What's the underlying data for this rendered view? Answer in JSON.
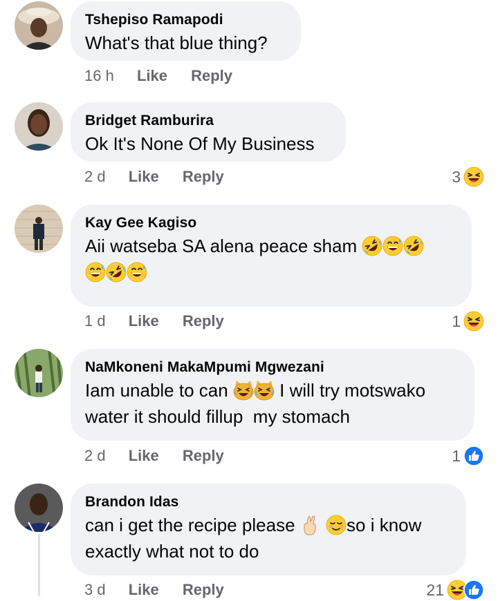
{
  "comments": [
    {
      "author": "Tshepiso Ramapodi",
      "text": "What's that blue thing?",
      "time": "16 h",
      "like": "Like",
      "reply": "Reply",
      "reaction_count": ""
    },
    {
      "author": "Bridget Ramburira",
      "text": "Ok It's None Of My Business",
      "time": "2 d",
      "like": "Like",
      "reply": "Reply",
      "reaction_count": "3"
    },
    {
      "author": "Kay Gee Kagiso",
      "text_line1": "Aii watseba SA alena peace sham",
      "time": "1 d",
      "like": "Like",
      "reply": "Reply",
      "reaction_count": "1"
    },
    {
      "author": "NaMkoneni MakaMpumi Mgwezani",
      "text_a": "Iam unable to can",
      "text_b": "I will try motswako",
      "text_line2": "water it should fillup  my stomach",
      "time": "2 d",
      "like": "Like",
      "reply": "Reply",
      "reaction_count": "1"
    },
    {
      "author": "Brandon Idas",
      "text_a": "can i get the recipe please",
      "text_b": "so i know",
      "text_line2": "exactly what not to do",
      "time": "3 d",
      "like": "Like",
      "reply": "Reply",
      "reaction_count": "21"
    }
  ],
  "icons": {
    "laugh": "laughing-emoji-icon",
    "sweat": "grinning-sweat-emoji-icon",
    "rofl": "rolling-laughing-emoji-icon",
    "cat": "cat-tears-of-joy-emoji-icon",
    "fingers": "crossed-fingers-emoji-icon",
    "relieved": "relieved-face-emoji-icon",
    "like": "like-reaction-icon"
  },
  "colors": {
    "bubble": "#f0f2f5",
    "meta": "#65676b",
    "like_blue": "#1877f2",
    "emoji_yellow": "#ffcc33"
  }
}
